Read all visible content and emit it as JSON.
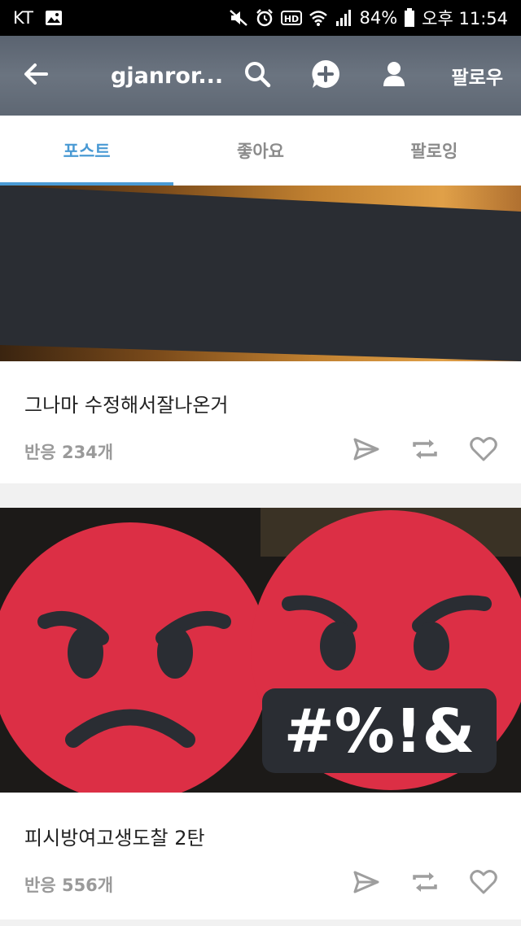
{
  "status_bar": {
    "carrier": "KT",
    "battery": "84%",
    "time": "오후 11:54",
    "hd_badge": "HD",
    "icons": [
      "image-icon",
      "mute-icon",
      "alarm-icon",
      "hd-icon",
      "wifi-icon",
      "signal-icon",
      "battery-icon"
    ]
  },
  "app_bar": {
    "title": "gjanror...",
    "follow_label": "팔로우",
    "icons": [
      "back-arrow-icon",
      "search-icon",
      "add-chat-icon",
      "profile-icon"
    ]
  },
  "tabs": [
    {
      "label": "포스트",
      "active": true
    },
    {
      "label": "좋아요",
      "active": false
    },
    {
      "label": "팔로잉",
      "active": false
    }
  ],
  "posts": [
    {
      "title": "그나마 수정해서잘나온거",
      "reactions": "반응 234개"
    },
    {
      "title": "피시방여고생도찰 2탄",
      "reactions": "반응 556개",
      "image_text": "#%!&"
    }
  ],
  "colors": {
    "accent": "#4a9ad4",
    "angry_red": "#dc2f45",
    "dark_overlay": "#2a2d33"
  }
}
